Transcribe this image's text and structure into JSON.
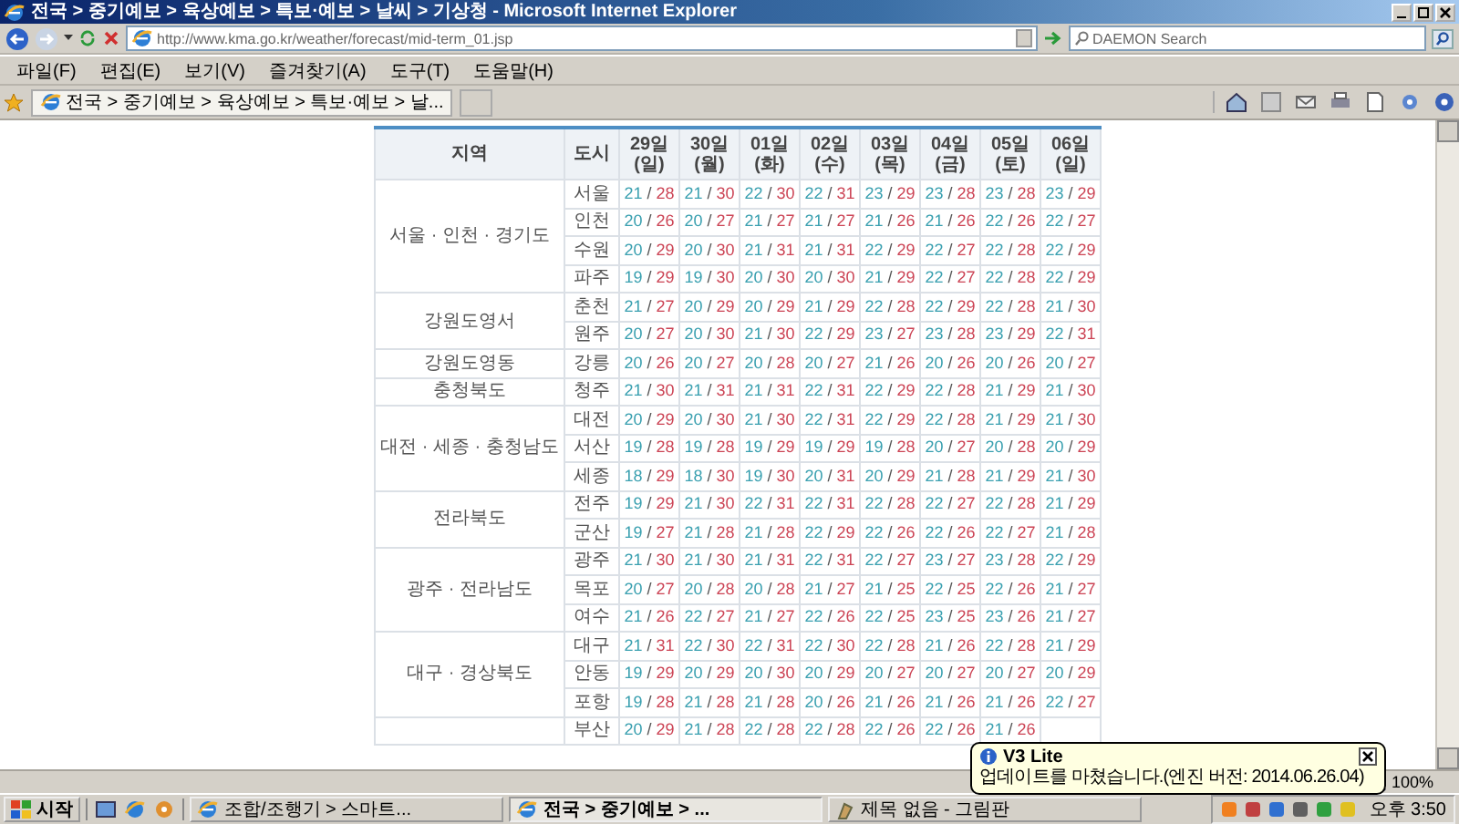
{
  "window": {
    "title": "전국 > 중기예보 > 육상예보 > 특보·예보 > 날씨 > 기상청 - Microsoft Internet Explorer"
  },
  "address_bar": {
    "url": "http://www.kma.go.kr/weather/forecast/mid-term_01.jsp",
    "search_placeholder": "DAEMON Search"
  },
  "menu": [
    "파일(F)",
    "편집(E)",
    "보기(V)",
    "즐겨찾기(A)",
    "도구(T)",
    "도움말(H)"
  ],
  "tab": {
    "label": "전국 > 중기예보 > 육상예보 > 특보·예보 > 날..."
  },
  "forecast_table": {
    "region_header": "지역",
    "city_header": "도시",
    "separator": "/",
    "dates": [
      {
        "day": "29일",
        "weekday": "(일)"
      },
      {
        "day": "30일",
        "weekday": "(월)"
      },
      {
        "day": "01일",
        "weekday": "(화)"
      },
      {
        "day": "02일",
        "weekday": "(수)"
      },
      {
        "day": "03일",
        "weekday": "(목)"
      },
      {
        "day": "04일",
        "weekday": "(금)"
      },
      {
        "day": "05일",
        "weekday": "(토)"
      },
      {
        "day": "06일",
        "weekday": "(일)"
      }
    ],
    "regions": [
      {
        "name": "서울 · 인천 · 경기도",
        "cities": [
          {
            "name": "서울",
            "temps": [
              [
                "21",
                "28"
              ],
              [
                "21",
                "30"
              ],
              [
                "22",
                "30"
              ],
              [
                "22",
                "31"
              ],
              [
                "23",
                "29"
              ],
              [
                "23",
                "28"
              ],
              [
                "23",
                "28"
              ],
              [
                "23",
                "29"
              ]
            ]
          },
          {
            "name": "인천",
            "temps": [
              [
                "20",
                "26"
              ],
              [
                "20",
                "27"
              ],
              [
                "21",
                "27"
              ],
              [
                "21",
                "27"
              ],
              [
                "21",
                "26"
              ],
              [
                "21",
                "26"
              ],
              [
                "22",
                "26"
              ],
              [
                "22",
                "27"
              ]
            ]
          },
          {
            "name": "수원",
            "temps": [
              [
                "20",
                "29"
              ],
              [
                "20",
                "30"
              ],
              [
                "21",
                "31"
              ],
              [
                "21",
                "31"
              ],
              [
                "22",
                "29"
              ],
              [
                "22",
                "27"
              ],
              [
                "22",
                "28"
              ],
              [
                "22",
                "29"
              ]
            ]
          },
          {
            "name": "파주",
            "temps": [
              [
                "19",
                "29"
              ],
              [
                "19",
                "30"
              ],
              [
                "20",
                "30"
              ],
              [
                "20",
                "30"
              ],
              [
                "21",
                "29"
              ],
              [
                "22",
                "27"
              ],
              [
                "22",
                "28"
              ],
              [
                "22",
                "29"
              ]
            ]
          }
        ]
      },
      {
        "name": "강원도영서",
        "cities": [
          {
            "name": "춘천",
            "temps": [
              [
                "21",
                "27"
              ],
              [
                "20",
                "29"
              ],
              [
                "20",
                "29"
              ],
              [
                "21",
                "29"
              ],
              [
                "22",
                "28"
              ],
              [
                "22",
                "29"
              ],
              [
                "22",
                "28"
              ],
              [
                "21",
                "30"
              ]
            ]
          },
          {
            "name": "원주",
            "temps": [
              [
                "20",
                "27"
              ],
              [
                "20",
                "30"
              ],
              [
                "21",
                "30"
              ],
              [
                "22",
                "29"
              ],
              [
                "23",
                "27"
              ],
              [
                "23",
                "28"
              ],
              [
                "23",
                "29"
              ],
              [
                "22",
                "31"
              ]
            ]
          }
        ]
      },
      {
        "name": "강원도영동",
        "cities": [
          {
            "name": "강릉",
            "temps": [
              [
                "20",
                "26"
              ],
              [
                "20",
                "27"
              ],
              [
                "20",
                "28"
              ],
              [
                "20",
                "27"
              ],
              [
                "21",
                "26"
              ],
              [
                "20",
                "26"
              ],
              [
                "20",
                "26"
              ],
              [
                "20",
                "27"
              ]
            ]
          }
        ]
      },
      {
        "name": "충청북도",
        "cities": [
          {
            "name": "청주",
            "temps": [
              [
                "21",
                "30"
              ],
              [
                "21",
                "31"
              ],
              [
                "21",
                "31"
              ],
              [
                "22",
                "31"
              ],
              [
                "22",
                "29"
              ],
              [
                "22",
                "28"
              ],
              [
                "21",
                "29"
              ],
              [
                "21",
                "30"
              ]
            ]
          }
        ]
      },
      {
        "name": "대전 · 세종 · 충청남도",
        "cities": [
          {
            "name": "대전",
            "temps": [
              [
                "20",
                "29"
              ],
              [
                "20",
                "30"
              ],
              [
                "21",
                "30"
              ],
              [
                "22",
                "31"
              ],
              [
                "22",
                "29"
              ],
              [
                "22",
                "28"
              ],
              [
                "21",
                "29"
              ],
              [
                "21",
                "30"
              ]
            ]
          },
          {
            "name": "서산",
            "temps": [
              [
                "19",
                "28"
              ],
              [
                "19",
                "28"
              ],
              [
                "19",
                "29"
              ],
              [
                "19",
                "29"
              ],
              [
                "19",
                "28"
              ],
              [
                "20",
                "27"
              ],
              [
                "20",
                "28"
              ],
              [
                "20",
                "29"
              ]
            ]
          },
          {
            "name": "세종",
            "temps": [
              [
                "18",
                "29"
              ],
              [
                "18",
                "30"
              ],
              [
                "19",
                "30"
              ],
              [
                "20",
                "31"
              ],
              [
                "20",
                "29"
              ],
              [
                "21",
                "28"
              ],
              [
                "21",
                "29"
              ],
              [
                "21",
                "30"
              ]
            ]
          }
        ]
      },
      {
        "name": "전라북도",
        "cities": [
          {
            "name": "전주",
            "temps": [
              [
                "19",
                "29"
              ],
              [
                "21",
                "30"
              ],
              [
                "22",
                "31"
              ],
              [
                "22",
                "31"
              ],
              [
                "22",
                "28"
              ],
              [
                "22",
                "27"
              ],
              [
                "22",
                "28"
              ],
              [
                "21",
                "29"
              ]
            ]
          },
          {
            "name": "군산",
            "temps": [
              [
                "19",
                "27"
              ],
              [
                "21",
                "28"
              ],
              [
                "21",
                "28"
              ],
              [
                "22",
                "29"
              ],
              [
                "22",
                "26"
              ],
              [
                "22",
                "26"
              ],
              [
                "22",
                "27"
              ],
              [
                "21",
                "28"
              ]
            ]
          }
        ]
      },
      {
        "name": "광주 · 전라남도",
        "cities": [
          {
            "name": "광주",
            "temps": [
              [
                "21",
                "30"
              ],
              [
                "21",
                "30"
              ],
              [
                "21",
                "31"
              ],
              [
                "22",
                "31"
              ],
              [
                "22",
                "27"
              ],
              [
                "23",
                "27"
              ],
              [
                "23",
                "28"
              ],
              [
                "22",
                "29"
              ]
            ]
          },
          {
            "name": "목포",
            "temps": [
              [
                "20",
                "27"
              ],
              [
                "20",
                "28"
              ],
              [
                "20",
                "28"
              ],
              [
                "21",
                "27"
              ],
              [
                "21",
                "25"
              ],
              [
                "22",
                "25"
              ],
              [
                "22",
                "26"
              ],
              [
                "21",
                "27"
              ]
            ]
          },
          {
            "name": "여수",
            "temps": [
              [
                "21",
                "26"
              ],
              [
                "22",
                "27"
              ],
              [
                "21",
                "27"
              ],
              [
                "22",
                "26"
              ],
              [
                "22",
                "25"
              ],
              [
                "23",
                "25"
              ],
              [
                "23",
                "26"
              ],
              [
                "21",
                "27"
              ]
            ]
          }
        ]
      },
      {
        "name": "대구 · 경상북도",
        "cities": [
          {
            "name": "대구",
            "temps": [
              [
                "21",
                "31"
              ],
              [
                "22",
                "30"
              ],
              [
                "22",
                "31"
              ],
              [
                "22",
                "30"
              ],
              [
                "22",
                "28"
              ],
              [
                "21",
                "26"
              ],
              [
                "22",
                "28"
              ],
              [
                "21",
                "29"
              ]
            ]
          },
          {
            "name": "안동",
            "temps": [
              [
                "19",
                "29"
              ],
              [
                "20",
                "29"
              ],
              [
                "20",
                "30"
              ],
              [
                "20",
                "29"
              ],
              [
                "20",
                "27"
              ],
              [
                "20",
                "27"
              ],
              [
                "20",
                "27"
              ],
              [
                "20",
                "29"
              ]
            ]
          },
          {
            "name": "포항",
            "temps": [
              [
                "19",
                "28"
              ],
              [
                "21",
                "28"
              ],
              [
                "21",
                "28"
              ],
              [
                "20",
                "26"
              ],
              [
                "21",
                "26"
              ],
              [
                "21",
                "26"
              ],
              [
                "21",
                "26"
              ],
              [
                "22",
                "27"
              ]
            ]
          }
        ]
      },
      {
        "cities": [
          {
            "name": "부산",
            "temps": [
              [
                "20",
                "29"
              ],
              [
                "21",
                "28"
              ],
              [
                "22",
                "28"
              ],
              [
                "22",
                "28"
              ],
              [
                "22",
                "26"
              ],
              [
                "22",
                "26"
              ],
              [
                "21",
                "26"
              ]
            ]
          }
        ]
      }
    ]
  },
  "status_bar": {
    "zoom": "100%"
  },
  "taskbar": {
    "start": "시작",
    "tasks": [
      {
        "label": "조합/조행기 > 스마트...",
        "selected": false
      },
      {
        "label": "전국 > 중기예보 > ...",
        "selected": true
      },
      {
        "label": "제목 없음 - 그림판",
        "selected": false
      }
    ],
    "clock": "오후 3:50"
  },
  "notification": {
    "title": "V3 Lite",
    "message": "업데이트를 마쳤습니다.(엔진 버전: 2014.06.26.04)"
  }
}
